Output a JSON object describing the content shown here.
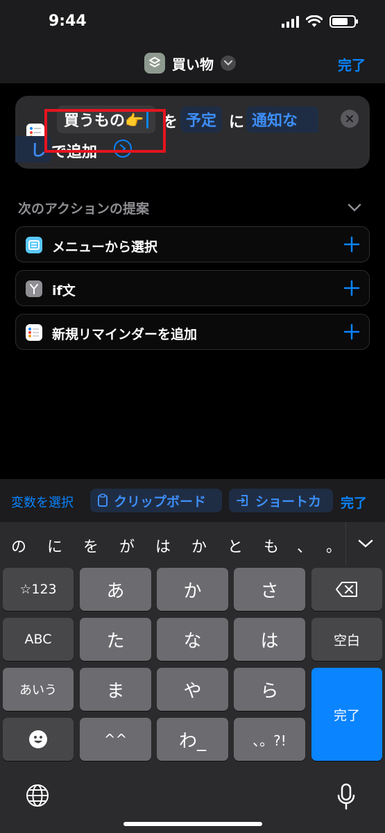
{
  "status": {
    "time": "9:44"
  },
  "nav": {
    "title": "買い物",
    "done": "完了"
  },
  "action": {
    "param": "買うもの👉",
    "text_wo": "を",
    "token_schedule": "予定",
    "text_ni": "に",
    "token_notify_1": "通知な",
    "token_notify_2": "し",
    "text_add": "で追加"
  },
  "suggestions": {
    "header": "次のアクションの提案",
    "items": [
      {
        "label": "メニューから選択",
        "icon": "menu-icon",
        "color": "#5ac8fa"
      },
      {
        "label": "if文",
        "icon": "branch-icon",
        "color": "#8e8e93"
      },
      {
        "label": "新規リマインダーを追加",
        "icon": "reminders-icon",
        "color": "#ffffff"
      }
    ]
  },
  "toolbar": {
    "variable": "変数を選択",
    "clipboard": "クリップボード",
    "shortcut": "ショートカ",
    "done": "完了"
  },
  "keyboard": {
    "candidates": [
      "の",
      "に",
      "を",
      "が",
      "は",
      "か",
      "と",
      "も",
      "、",
      "。"
    ],
    "keys": {
      "sym": "☆123",
      "a": "あ",
      "ka": "か",
      "sa": "さ",
      "abc": "ABC",
      "ta": "た",
      "na": "な",
      "ha": "は",
      "space": "空白",
      "aiu": "あいう",
      "ma": "ま",
      "ya": "や",
      "ra": "ら",
      "done": "完了",
      "dakuten": "^^",
      "wa": "わ_",
      "punct": "、。?!"
    }
  },
  "colors": {
    "accent": "#0a84ff",
    "highlight": "#e5141f"
  }
}
